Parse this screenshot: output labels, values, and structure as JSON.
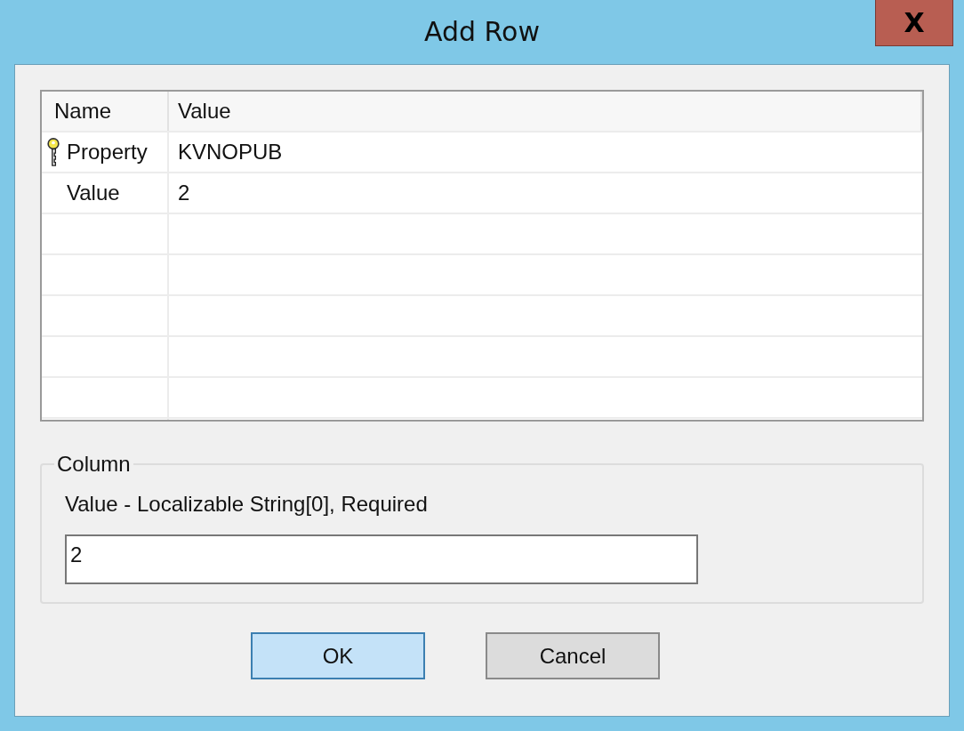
{
  "window": {
    "title": "Add Row",
    "close": "X"
  },
  "table": {
    "columns": [
      "Name",
      "Value"
    ],
    "rows": [
      {
        "name": "Property",
        "value": "KVNOPUB",
        "primary_key": true
      },
      {
        "name": "Value",
        "value": "2",
        "primary_key": false
      }
    ]
  },
  "column_group": {
    "title": "Column",
    "description": "Value - Localizable String[0], Required",
    "value": "2"
  },
  "buttons": [
    {
      "label": "OK",
      "default": true
    },
    {
      "label": "Cancel",
      "default": false
    }
  ]
}
